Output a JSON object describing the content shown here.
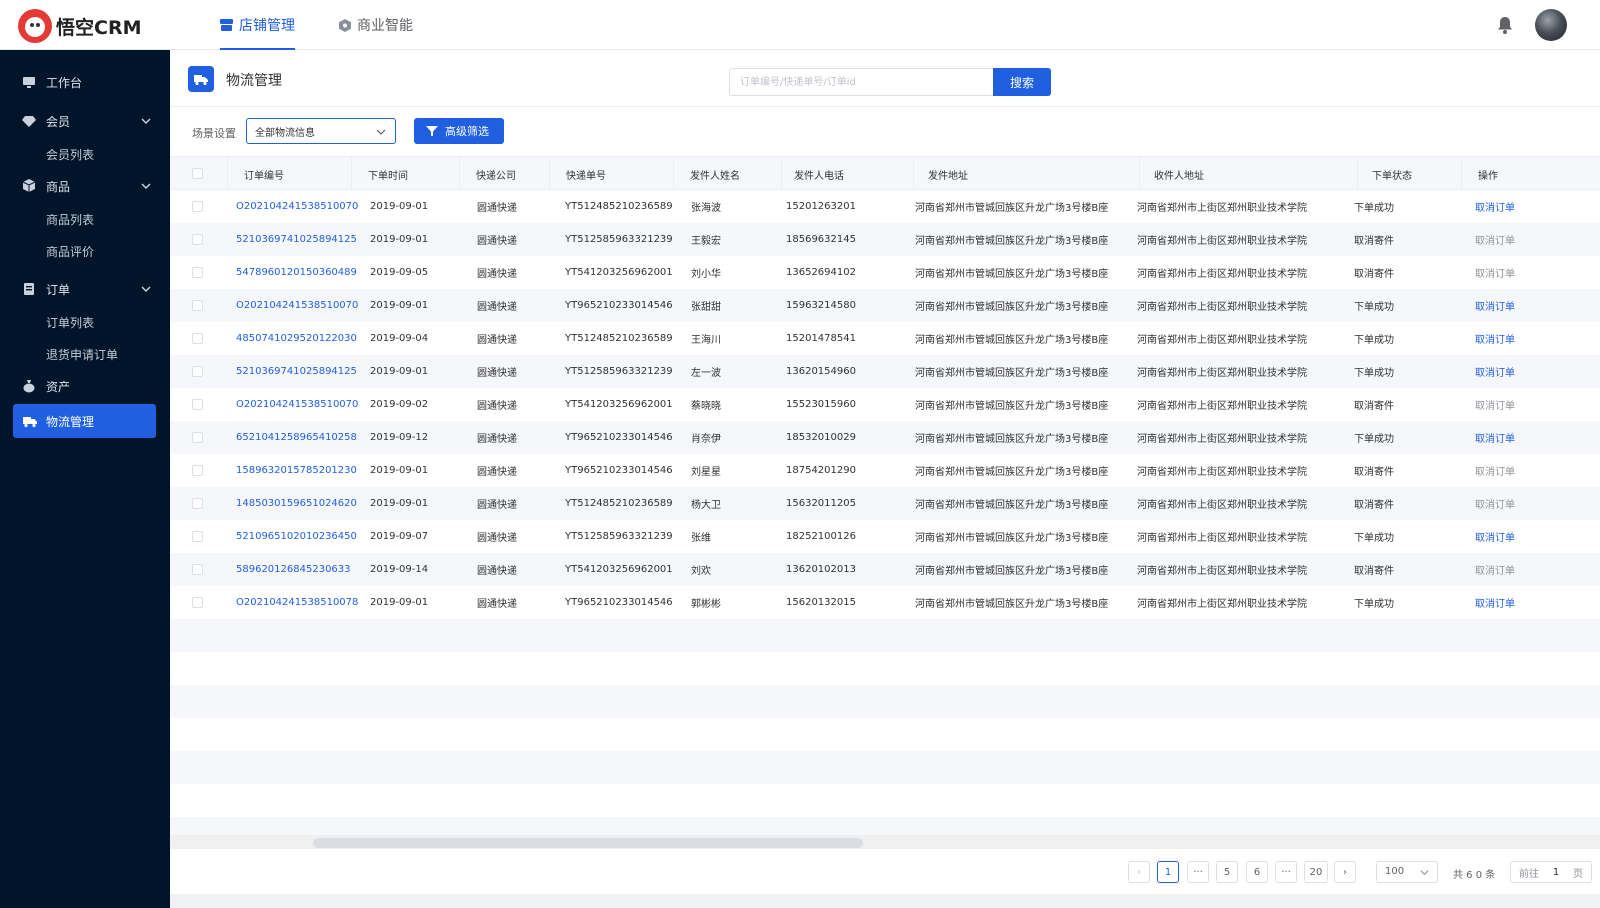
{
  "brand": {
    "name": "悟空CRM"
  },
  "top_nav": [
    {
      "label": "店铺管理",
      "active": true
    },
    {
      "label": "商业智能",
      "active": false
    }
  ],
  "sidebar": {
    "workbench": "工作台",
    "member": "会员",
    "member_list": "会员列表",
    "goods": "商品",
    "goods_list": "商品列表",
    "goods_review": "商品评价",
    "order": "订单",
    "order_list": "订单列表",
    "return_orders": "退货申请订单",
    "assets": "资产",
    "logistics": "物流管理"
  },
  "page": {
    "title": "物流管理",
    "search_placeholder": "订单编号/快递单号/订单id",
    "search_button": "搜索"
  },
  "filter": {
    "label": "场景设置",
    "scene_value": "全部物流信息",
    "advanced_button": "高级筛选"
  },
  "table": {
    "columns": [
      "订单编号",
      "下单时间",
      "快递公司",
      "快递单号",
      "发件人姓名",
      "发件人电话",
      "发件地址",
      "收件人地址",
      "下单状态",
      "操作"
    ],
    "rows": [
      [
        "O202104241538510070",
        "2019-09-01",
        "圆通快递",
        "YT512485210236589",
        "张海波",
        "15201263201",
        "河南省郑州市管城回族区升龙广场3号楼B座",
        "河南省郑州市上街区郑州职业技术学院",
        "下单成功",
        "取消订单"
      ],
      [
        "5210369741025894125",
        "2019-09-01",
        "圆通快递",
        "YT512585963321239",
        "王毅宏",
        "18569632145",
        "河南省郑州市管城回族区升龙广场3号楼B座",
        "河南省郑州市上街区郑州职业技术学院",
        "取消寄件",
        "取消订单"
      ],
      [
        "5478960120150360489",
        "2019-09-05",
        "圆通快递",
        "YT541203256962001",
        "刘小华",
        "13652694102",
        "河南省郑州市管城回族区升龙广场3号楼B座",
        "河南省郑州市上街区郑州职业技术学院",
        "取消寄件",
        "取消订单"
      ],
      [
        "O202104241538510070",
        "2019-09-01",
        "圆通快递",
        "YT965210233014546",
        "张甜甜",
        "15963214580",
        "河南省郑州市管城回族区升龙广场3号楼B座",
        "河南省郑州市上街区郑州职业技术学院",
        "下单成功",
        "取消订单"
      ],
      [
        "4850741029520122030",
        "2019-09-04",
        "圆通快递",
        "YT512485210236589",
        "王海川",
        "15201478541",
        "河南省郑州市管城回族区升龙广场3号楼B座",
        "河南省郑州市上街区郑州职业技术学院",
        "下单成功",
        "取消订单"
      ],
      [
        "5210369741025894125",
        "2019-09-01",
        "圆通快递",
        "YT512585963321239",
        "左一波",
        "13620154960",
        "河南省郑州市管城回族区升龙广场3号楼B座",
        "河南省郑州市上街区郑州职业技术学院",
        "下单成功",
        "取消订单"
      ],
      [
        "O202104241538510070",
        "2019-09-02",
        "圆通快递",
        "YT541203256962001",
        "蔡晓晓",
        "15523015960",
        "河南省郑州市管城回族区升龙广场3号楼B座",
        "河南省郑州市上街区郑州职业技术学院",
        "取消寄件",
        "取消订单"
      ],
      [
        "6521041258965410258",
        "2019-09-12",
        "圆通快递",
        "YT965210233014546",
        "肖奈伊",
        "18532010029",
        "河南省郑州市管城回族区升龙广场3号楼B座",
        "河南省郑州市上街区郑州职业技术学院",
        "下单成功",
        "取消订单"
      ],
      [
        "1589632015785201230",
        "2019-09-01",
        "圆通快递",
        "YT965210233014546",
        "刘星星",
        "18754201290",
        "河南省郑州市管城回族区升龙广场3号楼B座",
        "河南省郑州市上街区郑州职业技术学院",
        "取消寄件",
        "取消订单"
      ],
      [
        "1485030159651024620",
        "2019-09-01",
        "圆通快递",
        "YT512485210236589",
        "杨大卫",
        "15632011205",
        "河南省郑州市管城回族区升龙广场3号楼B座",
        "河南省郑州市上街区郑州职业技术学院",
        "取消寄件",
        "取消订单"
      ],
      [
        "5210965102010236450",
        "2019-09-07",
        "圆通快递",
        "YT512585963321239",
        "张维",
        "18252100126",
        "河南省郑州市管城回族区升龙广场3号楼B座",
        "河南省郑州市上街区郑州职业技术学院",
        "下单成功",
        "取消订单"
      ],
      [
        "589620126845230633",
        "2019-09-14",
        "圆通快递",
        "YT541203256962001",
        "刘欢",
        "13620102013",
        "河南省郑州市管城回族区升龙广场3号楼B座",
        "河南省郑州市上街区郑州职业技术学院",
        "取消寄件",
        "取消订单"
      ],
      [
        "O202104241538510078",
        "2019-09-01",
        "圆通快递",
        "YT965210233014546",
        "郭彬彬",
        "15620132015",
        "河南省郑州市管城回族区升龙广场3号楼B座",
        "河南省郑州市上街区郑州职业技术学院",
        "下单成功",
        "取消订单"
      ]
    ]
  },
  "pagination": {
    "prev": "‹",
    "pages": [
      "1",
      "···",
      "5",
      "6",
      "···",
      "20"
    ],
    "next": "›",
    "page_size": "100",
    "total": "共 6 0 条",
    "goto_label": "前往",
    "goto_value": "1",
    "goto_unit": "页"
  },
  "colors": {
    "primary": "#1f5fe0",
    "sidebar_bg": "#001529",
    "link": "#1f5fe0",
    "muted": "#909399"
  },
  "icons": {
    "workbench": "monitor-icon",
    "member": "diamond-icon",
    "goods": "box-icon",
    "order": "clipboard-icon",
    "assets": "moneybag-icon",
    "logistics": "truck-icon"
  }
}
